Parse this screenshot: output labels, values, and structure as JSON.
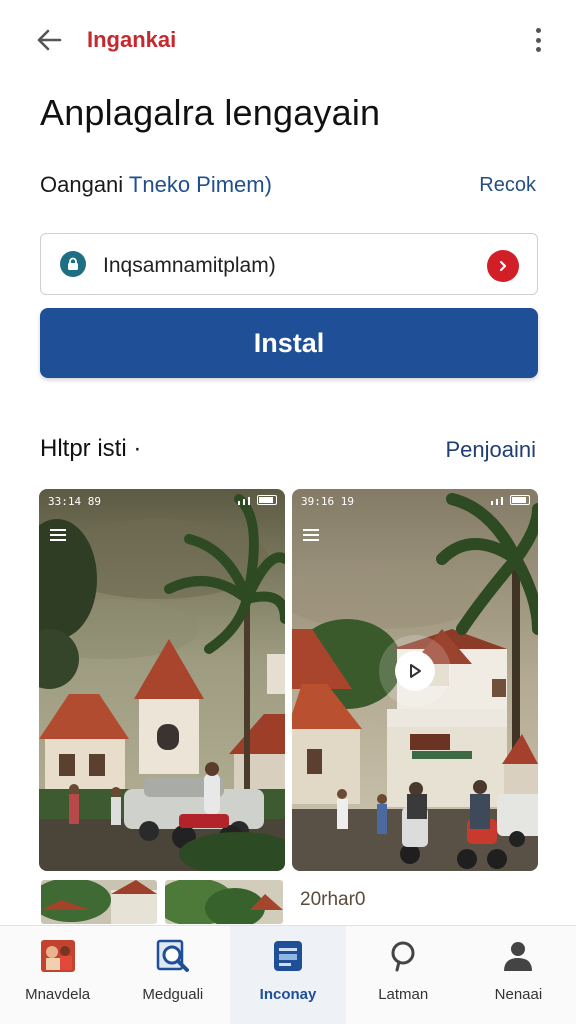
{
  "topbar": {
    "title": "Ingankai",
    "back_icon": "arrow-left-icon",
    "menu_icon": "more-vert-icon"
  },
  "headline": "Anplagalra lengayain",
  "subheader": {
    "left_prefix": "Oangani ",
    "left_highlight": "Tneko Pimem)",
    "right_link": "Recok"
  },
  "field": {
    "icon": "lock-icon",
    "value": "Inqsamnamitplam)",
    "action_icon": "chevron-right-icon"
  },
  "install_button": {
    "label": "Instal"
  },
  "section": {
    "title": "Hltpr isti ·",
    "link": "Penjoaini"
  },
  "screenshots": [
    {
      "status_time": "33:14 89",
      "has_menu": true,
      "has_play": false
    },
    {
      "status_time": "39:16 19",
      "has_menu": true,
      "has_play": true
    }
  ],
  "thumbs_label": "20rhar0",
  "nav": {
    "items": [
      {
        "label": "Mnavdela",
        "icon": "photo-app-icon"
      },
      {
        "label": "Medguali",
        "icon": "search-document-icon"
      },
      {
        "label": "Inconay",
        "icon": "card-icon",
        "active": true
      },
      {
        "label": "Latman",
        "icon": "chat-bubble-icon"
      },
      {
        "label": "Nenaai",
        "icon": "person-icon"
      }
    ]
  },
  "colors": {
    "brand_red": "#c5282f",
    "primary_blue": "#1f4f97",
    "link_blue": "#264f86"
  }
}
